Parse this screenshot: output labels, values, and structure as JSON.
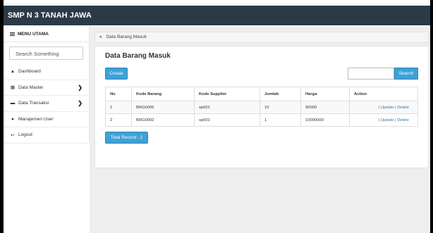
{
  "header": {
    "title": "SMP N 3 TANAH JAWA"
  },
  "sidebar": {
    "menu_title": "MENU UTAMA",
    "search_placeholder": "Search Something",
    "items": [
      {
        "label": "Dashboard",
        "icon": "home-icon",
        "has_arrow": false
      },
      {
        "label": "Data Master",
        "icon": "table-icon",
        "has_arrow": true
      },
      {
        "label": "Data Transaksi",
        "icon": "folder-icon",
        "has_arrow": true
      },
      {
        "label": "Manajemen User",
        "icon": "user-icon",
        "has_arrow": false
      },
      {
        "label": "Logout",
        "icon": "logout-icon",
        "has_arrow": false
      }
    ]
  },
  "breadcrumb": {
    "label": "Data Barang Masuk"
  },
  "main": {
    "title": "Data Barang Masuk",
    "create_label": "Create",
    "search_label": "Search",
    "total_label": "Total Record : 2",
    "table": {
      "headers": [
        "No",
        "Kode Barang",
        "Kode Supplier",
        "Jumlah",
        "Harga",
        "Action"
      ],
      "rows": [
        {
          "no": "1",
          "kode_barang": "BRG0006",
          "kode_supplier": "sp001",
          "jumlah": "10",
          "harga": "90000",
          "action": "| Update | Delete"
        },
        {
          "no": "2",
          "kode_barang": "BRG0002",
          "kode_supplier": "sp001",
          "jumlah": "1",
          "harga": "10000000",
          "action": "| Update | Delete"
        }
      ]
    }
  },
  "colors": {
    "topbar": "#2c3a48",
    "accent": "#3fa1d6",
    "link": "#2a7ab0"
  }
}
